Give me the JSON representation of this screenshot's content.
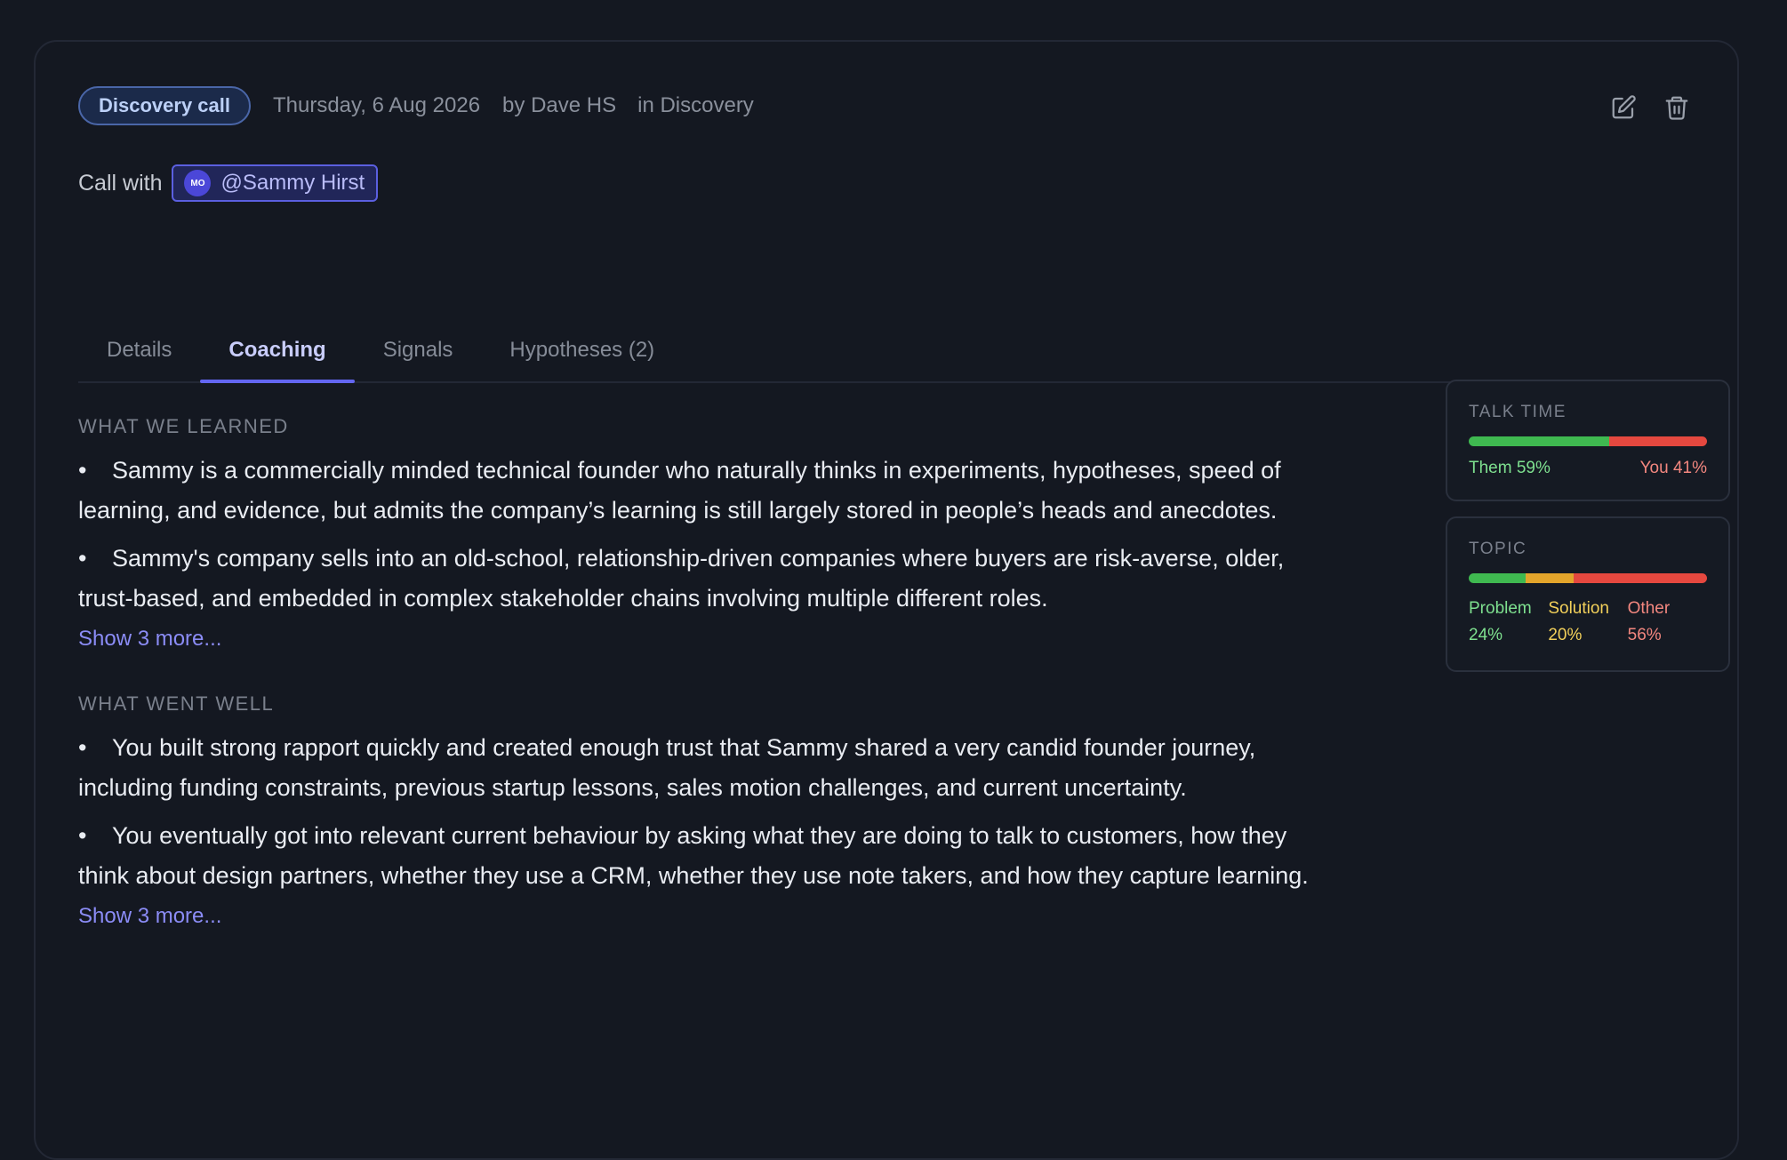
{
  "call": {
    "type_label": "Discovery call",
    "date": "Thursday, 6 Aug 2026",
    "by": "by Dave HS",
    "in": "in Discovery",
    "call_with_label": "Call with",
    "contact_initials": "MO",
    "contact_mention": "@Sammy Hirst"
  },
  "actions": {
    "edit_icon": "edit-icon",
    "delete_icon": "trash-icon"
  },
  "tabs": [
    {
      "label": "Details",
      "active": false
    },
    {
      "label": "Coaching",
      "active": true
    },
    {
      "label": "Signals",
      "active": false
    },
    {
      "label": "Hypotheses (2)",
      "active": false
    }
  ],
  "learned": {
    "title": "WHAT WE LEARNED",
    "items": [
      "Sammy is a commercially minded technical founder who naturally thinks in experiments, hypotheses, speed of learning, and evidence, but admits the company’s learning is still largely stored in people’s heads and anecdotes.",
      "Sammy's company sells into an old-school, relationship-driven companies where buyers are risk-averse, older, trust-based, and embedded in complex stakeholder chains involving multiple different roles."
    ],
    "show_more": "Show 3 more..."
  },
  "went_well": {
    "title": "WHAT WENT WELL",
    "items": [
      "You built strong rapport quickly and created enough trust that Sammy shared a very candid founder journey, including funding constraints, previous startup lessons, sales motion challenges, and current uncertainty.",
      "You eventually got into relevant current behaviour by asking what they are doing to talk to customers, how they think about design partners, whether they use a CRM, whether they use note takers, and how they capture learning."
    ],
    "show_more": "Show 3 more..."
  },
  "talk_time": {
    "title": "TALK TIME",
    "them_label": "Them 59%",
    "you_label": "You 41%",
    "them_pct": 59,
    "you_pct": 41,
    "them_color": "#3fb950",
    "you_color": "#e5483f"
  },
  "topic": {
    "title": "TOPIC",
    "segments": [
      {
        "name": "Problem",
        "pct_label": "24%",
        "pct": 24,
        "color": "#3fb950",
        "text_color": "#7ee08f"
      },
      {
        "name": "Solution",
        "pct_label": "20%",
        "pct": 20,
        "color": "#e3a52b",
        "text_color": "#f2d05a"
      },
      {
        "name": "Other",
        "pct_label": "56%",
        "pct": 56,
        "color": "#e5483f",
        "text_color": "#f3877f"
      }
    ]
  },
  "colors": {
    "accent": "#6366f1",
    "background": "#141821"
  }
}
